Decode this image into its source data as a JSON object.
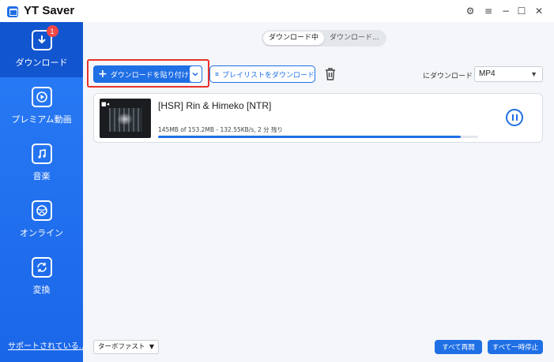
{
  "window": {
    "title": "YT Saver",
    "controls": {
      "settings": "⚙",
      "menu": "≡",
      "minimize": "−",
      "maximize": "☐",
      "close": "✕"
    }
  },
  "sidebar": {
    "items": [
      {
        "label": "ダウンロード",
        "icon": "download-icon",
        "badge": "1",
        "active": true
      },
      {
        "label": "プレミアム動画",
        "icon": "play-icon"
      },
      {
        "label": "音楽",
        "icon": "music-icon"
      },
      {
        "label": "オンライン",
        "icon": "globe-icon"
      },
      {
        "label": "変換",
        "icon": "convert-icon"
      }
    ],
    "support_link": "サポートされている..."
  },
  "main": {
    "tabs": [
      {
        "label": "ダウンロード中",
        "active": true
      },
      {
        "label": "ダウンロード..."
      }
    ],
    "toolbar": {
      "paste_label": "ダウンロードを貼り付け",
      "playlist_label": "プレイリストをダウンロード",
      "download_to_label": "にダウンロード",
      "format_value": "MP4"
    },
    "downloads": [
      {
        "title": "[HSR] Rin & Himeko [NTR]",
        "status": "145MB of 153.2MB -  132.55KB/s, 2 分 残り",
        "progress": 0.946
      }
    ],
    "footer": {
      "speed_value": "ターボファスト",
      "resume_all": "すべて再開",
      "pause_all": "すべて一時停止"
    }
  },
  "colors": {
    "accent": "#1f6fe5",
    "sidebar": "#1d6ff0",
    "highlight": "#e8322b",
    "badge": "#f04848"
  }
}
